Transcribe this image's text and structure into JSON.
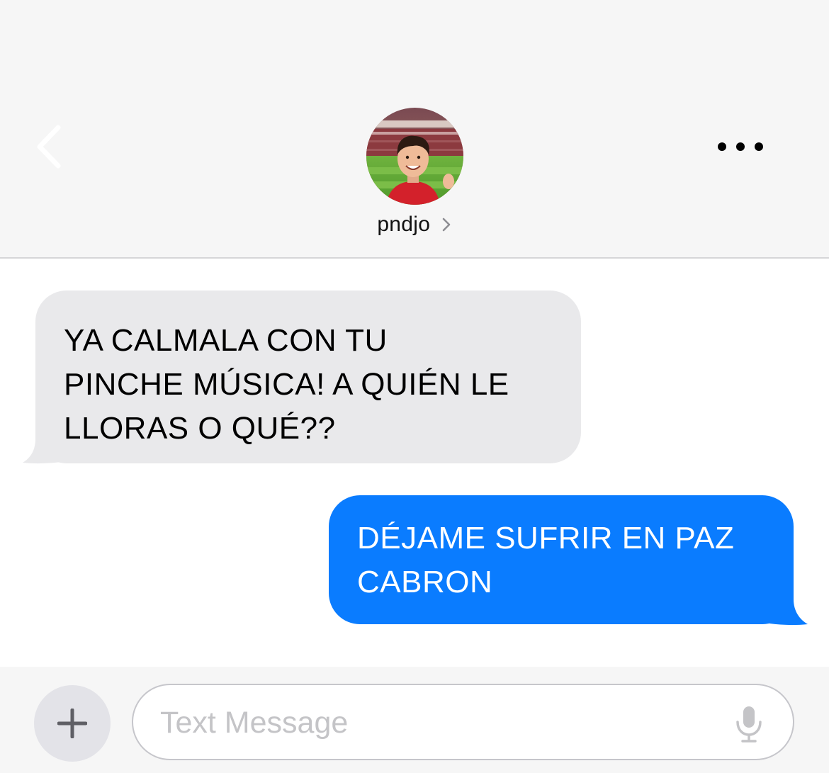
{
  "header": {
    "back_icon": "chevron-left-icon",
    "more_icon": "ellipsis-icon",
    "contact": {
      "name": "pndjo",
      "avatar": "contact-avatar-photo",
      "disclosure_icon": "chevron-right-icon"
    }
  },
  "messages": [
    {
      "direction": "incoming",
      "text": "YA CALMALA CON TU\nPINCHE MÚSICA! A QUIÉN LE\nLLORAS O QUÉ??"
    },
    {
      "direction": "outgoing",
      "text": "DÉJAME SUFRIR EN PAZ\nCABRON"
    }
  ],
  "composer": {
    "add_icon": "plus-icon",
    "placeholder": "Text Message",
    "value": "",
    "mic_icon": "microphone-icon"
  },
  "colors": {
    "header_bg": "#f6f6f6",
    "incoming_bubble": "#e9e9eb",
    "outgoing_bubble": "#0a7cff",
    "accent": "#0a7cff"
  }
}
